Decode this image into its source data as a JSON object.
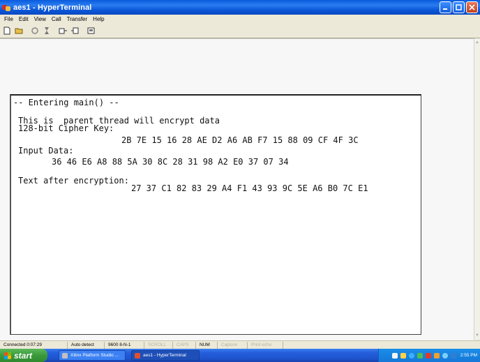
{
  "window": {
    "title": "aes1 - HyperTerminal"
  },
  "menu": [
    "File",
    "Edit",
    "View",
    "Call",
    "Transfer",
    "Help"
  ],
  "toolbar": [
    "new-icon",
    "open-icon",
    "disconnect-icon",
    "connect-icon",
    "send-icon",
    "receive-icon",
    "properties-icon"
  ],
  "terminal": {
    "lines": [
      "-- Entering main() --",
      "This is  parent thread will encrypt data",
      "128-bit Cipher Key:",
      "2B 7E 15 16 28 AE D2 A6 AB F7 15 88 09 CF 4F 3C",
      "Input Data:",
      "36 46 E6 A8 88 5A 30 8C 28 31 98 A2 E0 37 07 34",
      "Text after encryption:",
      "27 37 C1 82 83 29 A4 F1 43 93 9C 5E A6 B0 7C E1"
    ]
  },
  "status": {
    "connected": "Connected 0:07:29",
    "detect": "Auto detect",
    "settings": "9600 8-N-1",
    "scroll": "SCROLL",
    "caps": "CAPS",
    "num": "NUM",
    "capture": "Capture",
    "print_echo": "Print echo"
  },
  "taskbar": {
    "start": "start",
    "tasks": [
      "Xilinx Platform Studio ...",
      "aes1 - HyperTerminal"
    ],
    "clock": "2:55 PM"
  },
  "colors": {
    "titlebar": "#0a5bde",
    "start": "#3a9a3a",
    "taskbar": "#245edb"
  }
}
